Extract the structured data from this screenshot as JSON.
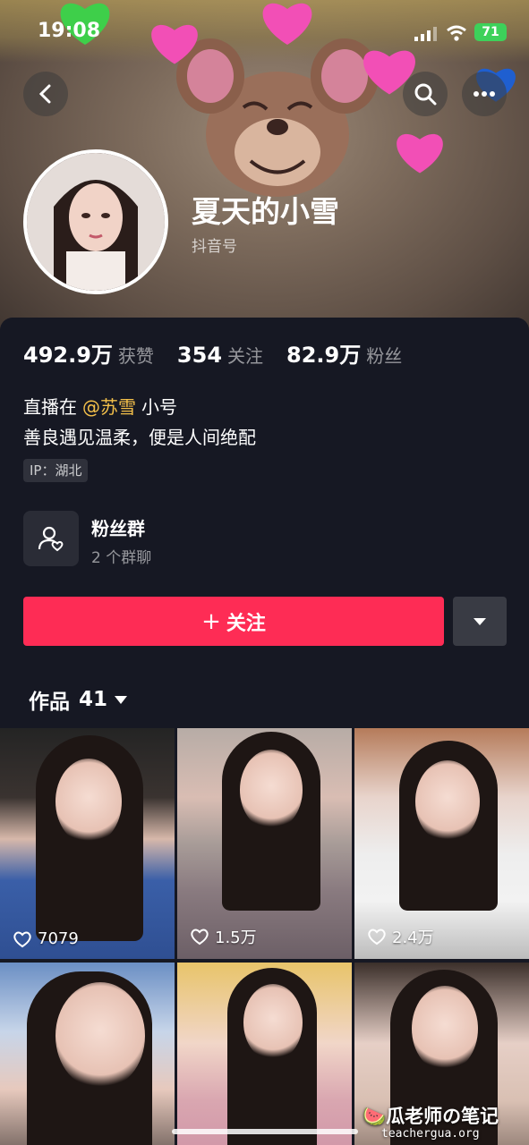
{
  "status_bar": {
    "time": "19:08",
    "battery": "71"
  },
  "profile": {
    "nickname": "夏天的小雪",
    "douyin_id_label": "抖音号"
  },
  "stats": [
    {
      "value": "492.9万",
      "label": "获赞"
    },
    {
      "value": "354",
      "label": "关注"
    },
    {
      "value": "82.9万",
      "label": "粉丝"
    }
  ],
  "bio": {
    "line1_prefix": "直播在",
    "mention": "@苏雪",
    "line1_suffix": "小号",
    "line2": "善良遇见温柔，便是人间绝配",
    "ip": "IP：湖北"
  },
  "fan_group": {
    "title": "粉丝群",
    "subtitle": "2 个群聊"
  },
  "follow_button": {
    "plus": "+",
    "label": "关注"
  },
  "works_tab": {
    "label": "作品",
    "count": "41"
  },
  "videos": [
    {
      "likes": "7079"
    },
    {
      "likes": "1.5万"
    },
    {
      "likes": "2.4万"
    },
    {
      "likes": ""
    },
    {
      "likes": ""
    },
    {
      "likes": ""
    }
  ],
  "watermark": {
    "text": "🍉瓜老师の笔记",
    "url": "teachergua.org"
  },
  "colors": {
    "accent": "#fe2c55",
    "mention": "#f4c04a",
    "background": "#161823"
  }
}
